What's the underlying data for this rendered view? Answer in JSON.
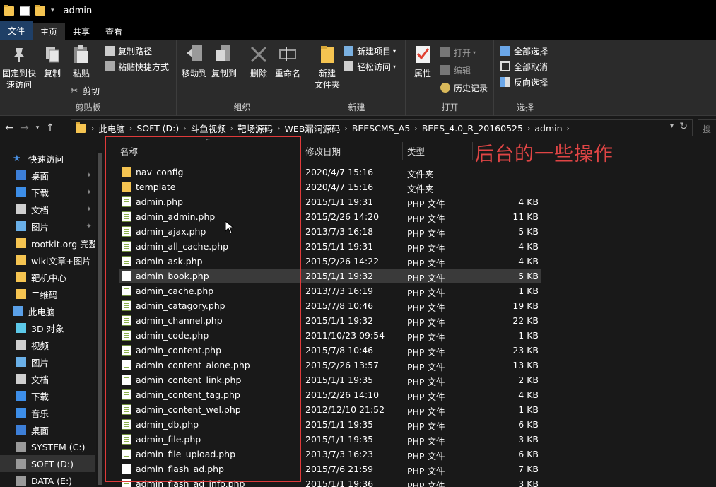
{
  "window": {
    "title": "admin"
  },
  "tabs": [
    "文件",
    "主页",
    "共享",
    "查看"
  ],
  "ribbon": {
    "clipboard": {
      "label": "剪贴板",
      "pin": "固定到快速访问",
      "copy": "复制",
      "paste": "粘贴",
      "copy_path": "复制路径",
      "paste_shortcut": "粘贴快捷方式",
      "cut": "剪切"
    },
    "organize": {
      "label": "组织",
      "move_to": "移动到",
      "copy_to": "复制到",
      "delete": "删除",
      "rename": "重命名"
    },
    "new": {
      "label": "新建",
      "new_folder": "新建\n文件夹",
      "new_item": "新建项目",
      "easy_access": "轻松访问"
    },
    "open": {
      "label": "打开",
      "properties": "属性",
      "open": "打开",
      "edit": "编辑",
      "history": "历史记录"
    },
    "select": {
      "label": "选择",
      "select_all": "全部选择",
      "select_none": "全部取消",
      "invert": "反向选择"
    }
  },
  "address": {
    "crumbs": [
      "此电脑",
      "SOFT (D:)",
      "斗鱼视频",
      "靶场源码",
      "WEB漏洞源码",
      "BEESCMS_A5",
      "BEES_4.0_R_20160525",
      "admin"
    ],
    "search_placeholder": "搜"
  },
  "sidebar": {
    "items": [
      {
        "label": "快速访问",
        "icon": "star-icon",
        "pinned": false
      },
      {
        "label": "桌面",
        "icon": "desktop-icon",
        "pinned": true
      },
      {
        "label": "下载",
        "icon": "download-icon",
        "pinned": true
      },
      {
        "label": "文档",
        "icon": "document-icon",
        "pinned": true
      },
      {
        "label": "图片",
        "icon": "picture-icon",
        "pinned": true
      },
      {
        "label": "rootkit.org 完整",
        "icon": "folder-icon",
        "pinned": false
      },
      {
        "label": "wiki文章+图片",
        "icon": "folder-icon",
        "pinned": false
      },
      {
        "label": "靶机中心",
        "icon": "folder-icon",
        "pinned": false
      },
      {
        "label": "二维码",
        "icon": "folder-icon",
        "pinned": false
      },
      {
        "label": "此电脑",
        "icon": "computer-icon",
        "pinned": false
      },
      {
        "label": "3D 对象",
        "icon": "3d-icon",
        "pinned": false
      },
      {
        "label": "视频",
        "icon": "video-icon",
        "pinned": false
      },
      {
        "label": "图片",
        "icon": "picture-icon",
        "pinned": false
      },
      {
        "label": "文档",
        "icon": "document-icon",
        "pinned": false
      },
      {
        "label": "下载",
        "icon": "download-icon",
        "pinned": false
      },
      {
        "label": "音乐",
        "icon": "music-icon",
        "pinned": false
      },
      {
        "label": "桌面",
        "icon": "desktop-icon",
        "pinned": false
      },
      {
        "label": "SYSTEM (C:)",
        "icon": "drive-icon",
        "pinned": false
      },
      {
        "label": "SOFT (D:)",
        "icon": "drive-icon",
        "pinned": false
      },
      {
        "label": "DATA (E:)",
        "icon": "drive-icon",
        "pinned": false
      }
    ]
  },
  "columns": {
    "name": "名称",
    "modified": "修改日期",
    "type": "类型"
  },
  "files": [
    {
      "name": "nav_config",
      "date": "2020/4/7 15:16",
      "type": "文件夹",
      "size": "",
      "kind": "folder"
    },
    {
      "name": "template",
      "date": "2020/4/7 15:16",
      "type": "文件夹",
      "size": "",
      "kind": "folder"
    },
    {
      "name": "admin.php",
      "date": "2015/1/1 19:31",
      "type": "PHP 文件",
      "size": "4 KB",
      "kind": "php"
    },
    {
      "name": "admin_admin.php",
      "date": "2015/2/26 14:20",
      "type": "PHP 文件",
      "size": "11 KB",
      "kind": "php"
    },
    {
      "name": "admin_ajax.php",
      "date": "2013/7/3 16:18",
      "type": "PHP 文件",
      "size": "5 KB",
      "kind": "php"
    },
    {
      "name": "admin_all_cache.php",
      "date": "2015/1/1 19:31",
      "type": "PHP 文件",
      "size": "4 KB",
      "kind": "php"
    },
    {
      "name": "admin_ask.php",
      "date": "2015/2/26 14:22",
      "type": "PHP 文件",
      "size": "4 KB",
      "kind": "php"
    },
    {
      "name": "admin_book.php",
      "date": "2015/1/1 19:32",
      "type": "PHP 文件",
      "size": "5 KB",
      "kind": "php"
    },
    {
      "name": "admin_cache.php",
      "date": "2013/7/3 16:19",
      "type": "PHP 文件",
      "size": "1 KB",
      "kind": "php"
    },
    {
      "name": "admin_catagory.php",
      "date": "2015/7/8 10:46",
      "type": "PHP 文件",
      "size": "19 KB",
      "kind": "php"
    },
    {
      "name": "admin_channel.php",
      "date": "2015/1/1 19:32",
      "type": "PHP 文件",
      "size": "22 KB",
      "kind": "php"
    },
    {
      "name": "admin_code.php",
      "date": "2011/10/23 09:54",
      "type": "PHP 文件",
      "size": "1 KB",
      "kind": "php"
    },
    {
      "name": "admin_content.php",
      "date": "2015/7/8 10:46",
      "type": "PHP 文件",
      "size": "23 KB",
      "kind": "php"
    },
    {
      "name": "admin_content_alone.php",
      "date": "2015/2/26 13:57",
      "type": "PHP 文件",
      "size": "13 KB",
      "kind": "php"
    },
    {
      "name": "admin_content_link.php",
      "date": "2015/1/1 19:35",
      "type": "PHP 文件",
      "size": "2 KB",
      "kind": "php"
    },
    {
      "name": "admin_content_tag.php",
      "date": "2015/2/26 14:10",
      "type": "PHP 文件",
      "size": "4 KB",
      "kind": "php"
    },
    {
      "name": "admin_content_wel.php",
      "date": "2012/12/10 21:52",
      "type": "PHP 文件",
      "size": "1 KB",
      "kind": "php"
    },
    {
      "name": "admin_db.php",
      "date": "2015/1/1 19:35",
      "type": "PHP 文件",
      "size": "6 KB",
      "kind": "php"
    },
    {
      "name": "admin_file.php",
      "date": "2015/1/1 19:35",
      "type": "PHP 文件",
      "size": "3 KB",
      "kind": "php"
    },
    {
      "name": "admin_file_upload.php",
      "date": "2013/7/3 16:23",
      "type": "PHP 文件",
      "size": "6 KB",
      "kind": "php"
    },
    {
      "name": "admin_flash_ad.php",
      "date": "2015/7/6 21:59",
      "type": "PHP 文件",
      "size": "7 KB",
      "kind": "php"
    },
    {
      "name": "admin_flash_ad_info.php",
      "date": "2015/1/1 19:36",
      "type": "PHP 文件",
      "size": "3 KB",
      "kind": "php"
    }
  ],
  "highlighted_file": "admin_book.php",
  "annotation": "后台的一些操作",
  "colors": {
    "annotation": "#e03a3a",
    "folder": "#f5c451",
    "accent_file_tab": "#1f3f66"
  }
}
